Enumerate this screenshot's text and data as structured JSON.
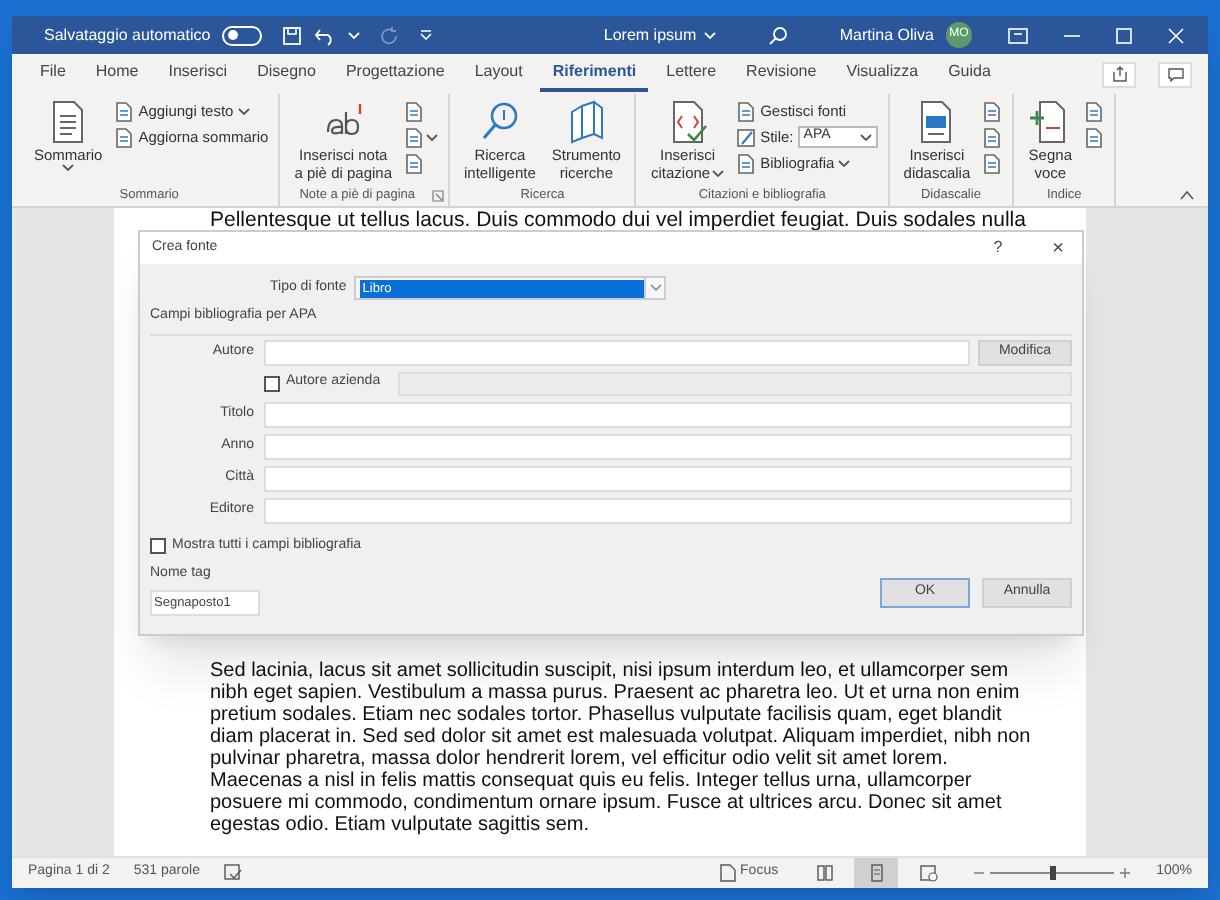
{
  "title_bar": {
    "autosave_label": "Salvataggio automatico",
    "autosave_on": false,
    "redo_disabled": true,
    "document_title": "Lorem ipsum",
    "user_name": "Martina Oliva",
    "avatar_initials": "MO"
  },
  "tabs": [
    {
      "label": "File",
      "selected": false
    },
    {
      "label": "Home",
      "selected": false
    },
    {
      "label": "Inserisci",
      "selected": false
    },
    {
      "label": "Disegno",
      "selected": false
    },
    {
      "label": "Progettazione",
      "selected": false
    },
    {
      "label": "Layout",
      "selected": false
    },
    {
      "label": "Riferimenti",
      "selected": true
    },
    {
      "label": "Lettere",
      "selected": false
    },
    {
      "label": "Revisione",
      "selected": false
    },
    {
      "label": "Visualizza",
      "selected": false
    },
    {
      "label": "Guida",
      "selected": false
    }
  ],
  "ribbon_groups": [
    {
      "label": "Sommario",
      "launcher": false,
      "items": [
        {
          "kind": "large",
          "lines": [
            "Sommario"
          ],
          "dropdown": true
        },
        {
          "kind": "small",
          "label": "Aggiungi testo",
          "dropdown": true
        },
        {
          "kind": "small",
          "label": "Aggiorna sommario",
          "dropdown": false
        }
      ]
    },
    {
      "label": "Note a piè di pagina",
      "launcher": true,
      "items": [
        {
          "kind": "large",
          "lines": [
            "Inserisci nota",
            "a piè di pagina"
          ],
          "dropdown": false
        },
        {
          "kind": "icon",
          "dropdown": false
        },
        {
          "kind": "icon",
          "dropdown": true
        },
        {
          "kind": "icon",
          "dropdown": false
        }
      ]
    },
    {
      "label": "Ricerca",
      "launcher": false,
      "items": [
        {
          "kind": "large",
          "lines": [
            "Ricerca",
            "intelligente"
          ],
          "dropdown": false
        },
        {
          "kind": "large",
          "lines": [
            "Strumento",
            "ricerche"
          ],
          "dropdown": false
        }
      ]
    },
    {
      "label": "Citazioni e bibliografia",
      "launcher": false,
      "items": [
        {
          "kind": "large",
          "lines": [
            "Inserisci",
            "citazione"
          ],
          "dropdown": true
        },
        {
          "kind": "small",
          "label": "Gestisci fonti",
          "dropdown": false
        },
        {
          "kind": "select",
          "label": "Stile:",
          "value": "APA"
        },
        {
          "kind": "small",
          "label": "Bibliografia",
          "dropdown": true
        }
      ]
    },
    {
      "label": "Didascalie",
      "launcher": false,
      "items": [
        {
          "kind": "large",
          "lines": [
            "Inserisci",
            "didascalia"
          ],
          "dropdown": false
        },
        {
          "kind": "icon",
          "dropdown": false
        },
        {
          "kind": "icon",
          "dropdown": false
        },
        {
          "kind": "icon",
          "dropdown": false
        }
      ]
    },
    {
      "label": "Indice",
      "launcher": false,
      "items": [
        {
          "kind": "large",
          "lines": [
            "Segna",
            "voce"
          ],
          "dropdown": false
        },
        {
          "kind": "icon",
          "dropdown": false
        },
        {
          "kind": "icon",
          "dropdown": false
        }
      ]
    }
  ],
  "document": {
    "top_line": "Pellentesque ut tellus lacus. Duis commodo dui vel imperdiet feugiat. Duis sodales nulla",
    "paragraph": "Sed lacinia, lacus sit amet sollicitudin suscipit, nisi ipsum interdum leo, et ullamcorper sem nibh eget sapien. Vestibulum a massa purus. Praesent ac pharetra leo. Ut et urna non enim pretium sodales. Etiam nec sodales tortor. Phasellus vulputate facilisis quam, eget blandit diam placerat in. Sed sed dolor sit amet est malesuada volutpat. Aliquam imperdiet, nibh non pulvinar pharetra, massa dolor hendrerit lorem, vel efficitur odio velit sit amet lorem. Maecenas a nisl in felis mattis consequat quis eu felis. Integer tellus urna, ullamcorper posuere mi commodo, condimentum ornare ipsum. Fusce at ultrices arcu. Donec sit amet egestas odio. Etiam vulputate sagittis sem."
  },
  "dialog": {
    "title": "Crea fonte",
    "help": "?",
    "close": "×",
    "source_type_label": "Tipo di fonte",
    "source_type_value": "Libro",
    "section_label": "Campi bibliografia per APA",
    "fields": [
      {
        "kind": "author",
        "label": "Autore",
        "button": "Modifica"
      },
      {
        "kind": "checkbox",
        "label": "Autore azienda",
        "checked": false,
        "disabled": true
      },
      {
        "kind": "text",
        "label": "Titolo"
      },
      {
        "kind": "text",
        "label": "Anno"
      },
      {
        "kind": "text",
        "label": "Città"
      },
      {
        "kind": "text",
        "label": "Editore"
      }
    ],
    "show_all_label": "Mostra tutti i campi bibliografia",
    "show_all_checked": false,
    "tag_label": "Nome tag",
    "tag_value": "Segnaposto1",
    "ok": "OK",
    "cancel": "Annulla"
  },
  "status_bar": {
    "page": "Pagina 1 di 2",
    "words": "531 parole",
    "focus": "Focus",
    "views": [
      {
        "selected": false
      },
      {
        "selected": true
      },
      {
        "selected": false
      }
    ],
    "zoom": {
      "level": 0.5,
      "reading": "100%"
    }
  }
}
